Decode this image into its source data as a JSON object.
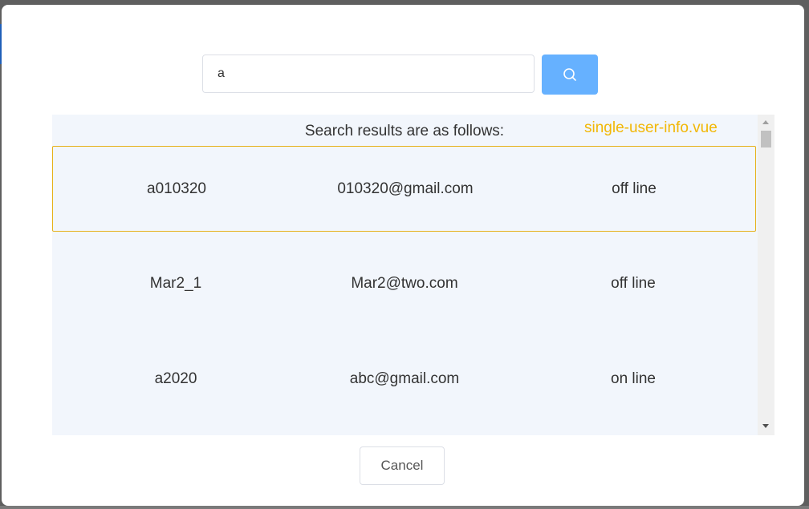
{
  "search": {
    "value": "a",
    "button_icon": "search-icon"
  },
  "results": {
    "heading": "Search results are as follows:",
    "file_tag": "single-user-info.vue",
    "rows": [
      {
        "username": "a010320",
        "email": "010320@gmail.com",
        "status": "off line",
        "selected": true
      },
      {
        "username": "Mar2_1",
        "email": "Mar2@two.com",
        "status": "off line",
        "selected": false
      },
      {
        "username": "a2020",
        "email": "abc@gmail.com",
        "status": "on line",
        "selected": false
      }
    ]
  },
  "footer": {
    "cancel_label": "Cancel"
  },
  "colors": {
    "accent": "#66b1ff",
    "selection_border": "#e6b11a",
    "file_tag": "#f2b705",
    "results_bg": "#f2f6fc"
  }
}
